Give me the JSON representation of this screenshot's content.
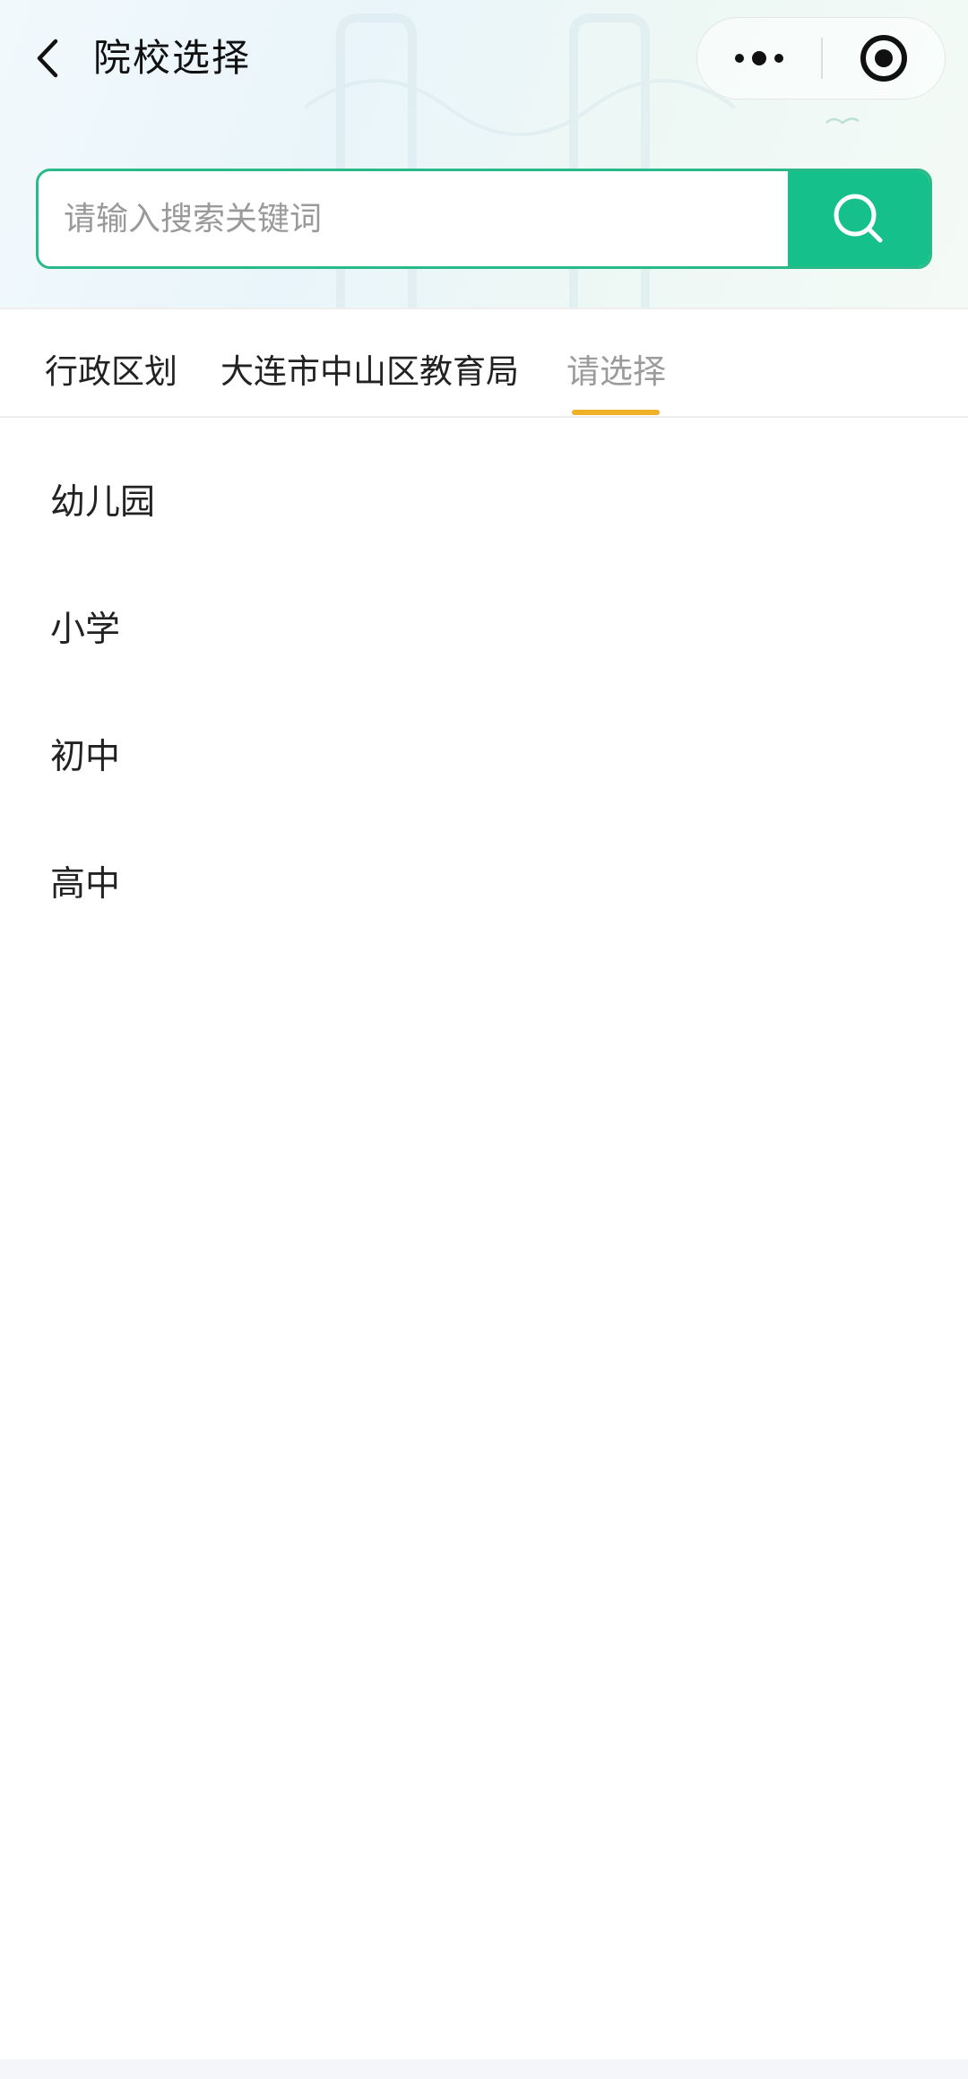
{
  "header": {
    "title": "院校选择",
    "back_icon": "chevron-left-icon",
    "capsule": {
      "more_icon": "more-dots-icon",
      "close_icon": "target-circle-icon"
    }
  },
  "search": {
    "placeholder": "请输入搜索关键词",
    "value": "",
    "button_icon": "search-icon",
    "accent_color": "#15c08a",
    "border_color": "#2bb98a"
  },
  "breadcrumb": {
    "tabs": [
      {
        "label": "行政区划",
        "active": false
      },
      {
        "label": "大连市中山区教育局",
        "active": false
      },
      {
        "label": "请选择",
        "active": true
      }
    ],
    "active_underline_color": "#f0b129"
  },
  "options": [
    {
      "label": "幼儿园"
    },
    {
      "label": "小学"
    },
    {
      "label": "初中"
    },
    {
      "label": "高中"
    }
  ]
}
